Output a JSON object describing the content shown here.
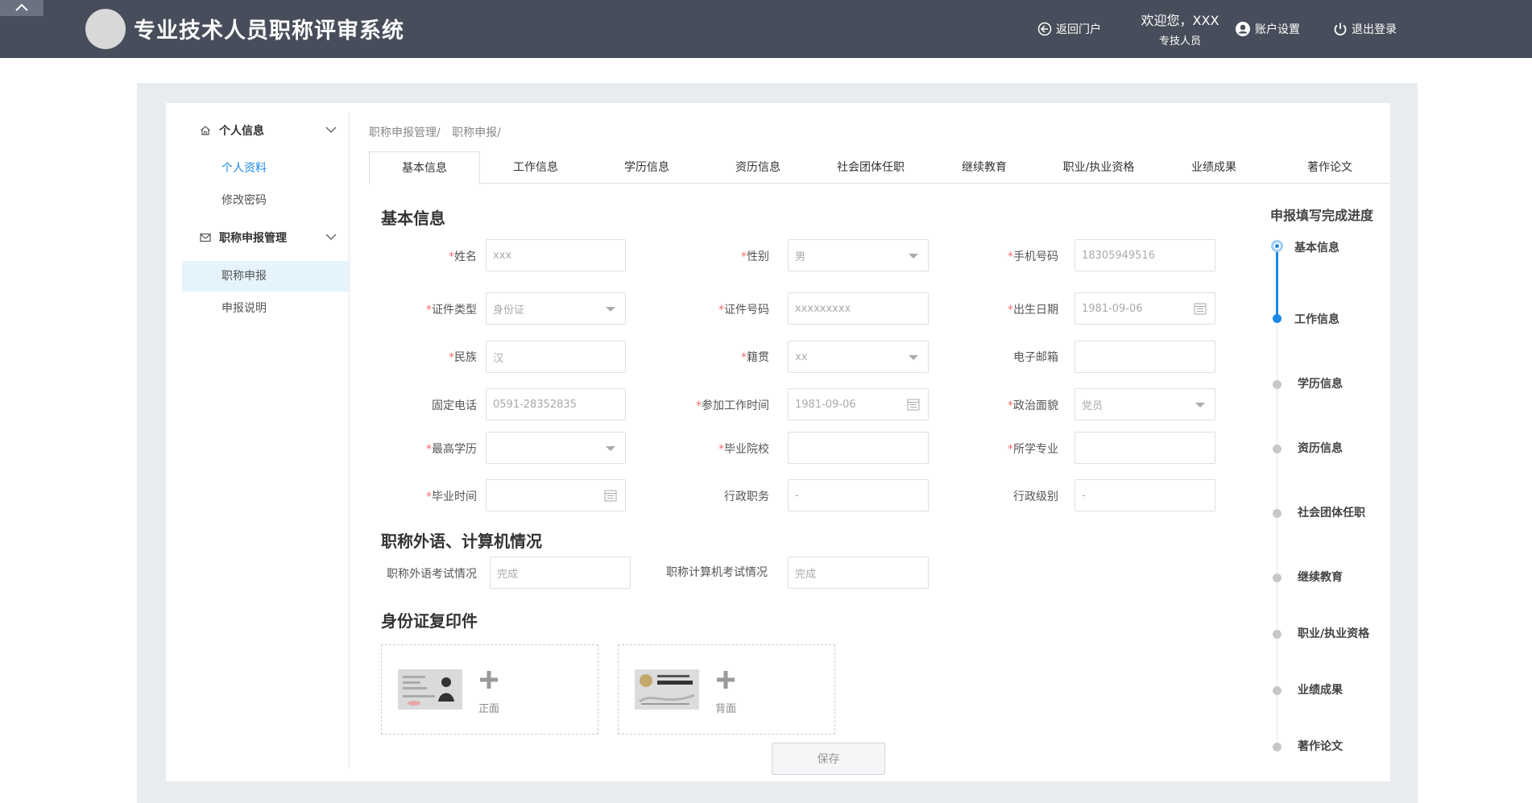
{
  "header": {
    "title": "专业技术人员职称评审系统",
    "back_portal": "返回门户",
    "welcome": "欢迎您，XXX",
    "role": "专技人员",
    "account_settings": "账户设置",
    "logout": "退出登录"
  },
  "sidebar": {
    "groups": [
      {
        "label": "个人信息",
        "items": [
          "个人资料",
          "修改密码"
        ]
      },
      {
        "label": "职称申报管理",
        "items": [
          "职称申报",
          "申报说明"
        ]
      }
    ]
  },
  "breadcrumb": [
    "职称申报管理/",
    "职称申报/"
  ],
  "tabs": [
    "基本信息",
    "工作信息",
    "学历信息",
    "资历信息",
    "社会团体任职",
    "继续教育",
    "职业/执业资格",
    "业绩成果",
    "著作论文"
  ],
  "sections": {
    "basic": "基本信息",
    "lang": "职称外语、计算机情况",
    "idcard": "身份证复印件"
  },
  "fields": {
    "name": {
      "label": "姓名",
      "value": "xxx"
    },
    "gender": {
      "label": "性别",
      "value": "男"
    },
    "phone": {
      "label": "手机号码",
      "value": "18305949516"
    },
    "id_type": {
      "label": "证件类型",
      "value": "身份证"
    },
    "id_no": {
      "label": "证件号码",
      "value": "xxxxxxxxx"
    },
    "birth": {
      "label": "出生日期",
      "value": "1981-09-06"
    },
    "ethnic": {
      "label": "民族",
      "value": "汉"
    },
    "origin": {
      "label": "籍贯",
      "value": "xx"
    },
    "email": {
      "label": "电子邮箱",
      "value": ""
    },
    "landline": {
      "label": "固定电话",
      "value": "0591-28352835"
    },
    "work_start": {
      "label": "参加工作时间",
      "value": "1981-09-06"
    },
    "political": {
      "label": "政治面貌",
      "value": "党员"
    },
    "edu": {
      "label": "最高学历",
      "value": ""
    },
    "school": {
      "label": "毕业院校",
      "value": ""
    },
    "major": {
      "label": "所学专业",
      "value": ""
    },
    "grad_time": {
      "label": "毕业时间",
      "value": ""
    },
    "admin_post": {
      "label": "行政职务",
      "value": "-"
    },
    "admin_level": {
      "label": "行政级别",
      "value": "-"
    },
    "lang_exam": {
      "label": "职称外语考试情况",
      "value": "完成"
    },
    "comp_exam": {
      "label": "职称计算机考试情况",
      "value": "完成"
    }
  },
  "uploads": {
    "front": "正面",
    "back": "背面"
  },
  "save": "保存",
  "progress": {
    "title": "申报填写完成进度",
    "steps": [
      "基本信息",
      "工作信息",
      "学历信息",
      "资历信息",
      "社会团体任职",
      "继续教育",
      "职业/执业资格",
      "业绩成果",
      "著作论文"
    ]
  },
  "colors": {
    "header_bg": "#474d5a",
    "accent": "#1e88e5",
    "required": "#f56c6c"
  }
}
